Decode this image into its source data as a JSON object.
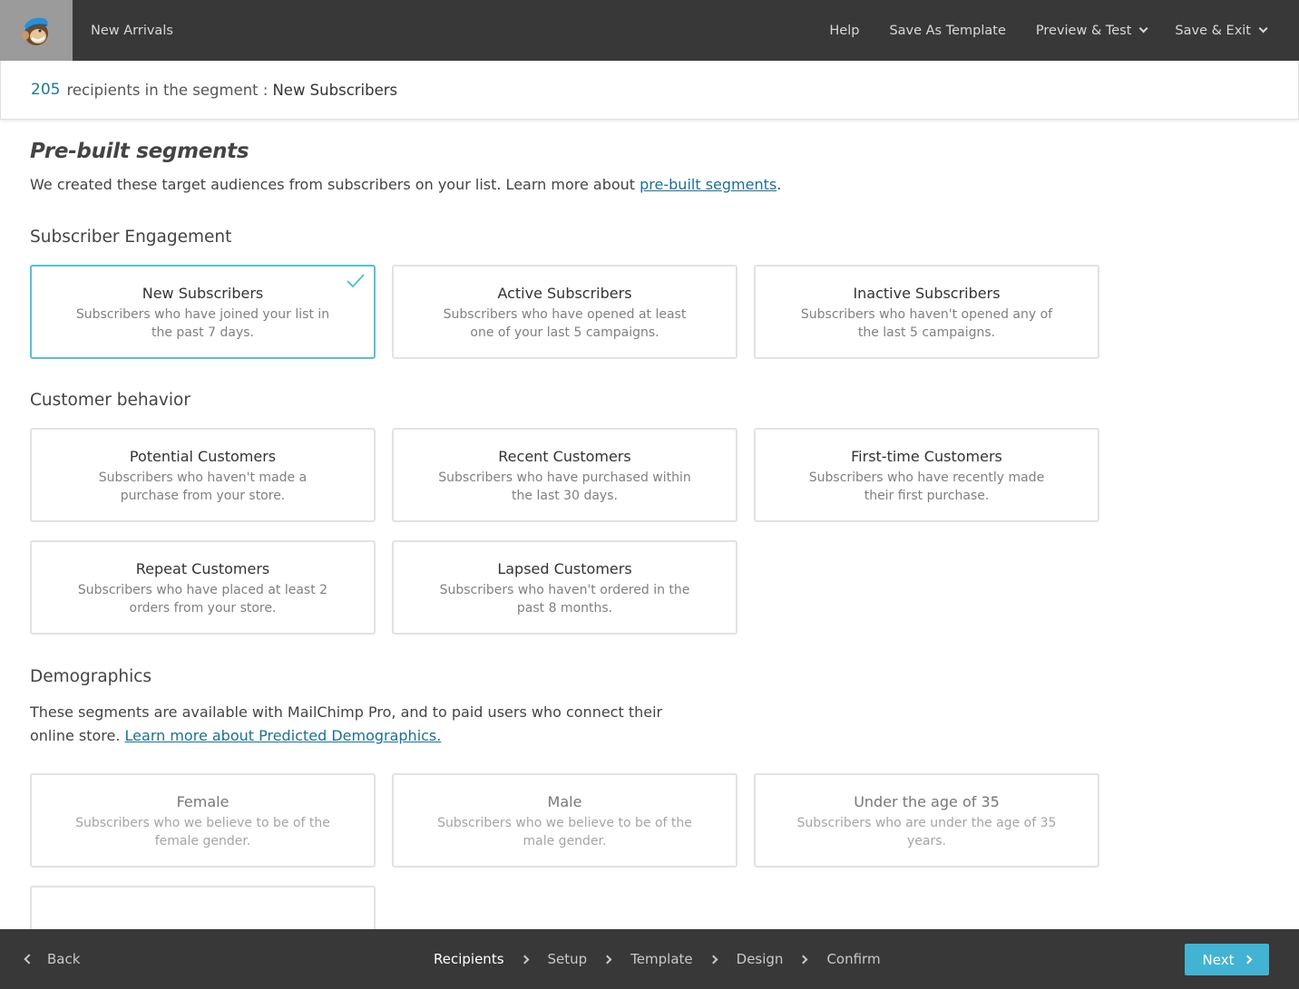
{
  "topbar": {
    "logo_icon": "mailchimp-freddie-logo",
    "campaign_name": "New Arrivals",
    "nav": [
      {
        "label": "Help",
        "dropdown": false
      },
      {
        "label": "Save As Template",
        "dropdown": false
      },
      {
        "label": "Preview & Test",
        "dropdown": true
      },
      {
        "label": "Save & Exit",
        "dropdown": true
      }
    ]
  },
  "recipients": {
    "count": "205",
    "label": "recipients in the segment :",
    "segment_name": "New Subscribers"
  },
  "colors": {
    "accent": "#43b3d3",
    "selected_border": "#5bbfd3",
    "link": "#1d6f95",
    "topbar_bg": "#383838"
  },
  "page": {
    "title": "Pre-built segments",
    "intro_text": "We created these target audiences from subscribers on your list. Learn more about ",
    "intro_link": "pre-built segments",
    "intro_end": "."
  },
  "sections": [
    {
      "heading": "Subscriber Engagement",
      "cards": [
        {
          "title": "New Subscribers",
          "desc": "Subscribers who have joined your list in the past 7 days.",
          "selected": true
        },
        {
          "title": "Active Subscribers",
          "desc": "Subscribers who have opened at least one of your last 5 campaigns.",
          "selected": false
        },
        {
          "title": "Inactive Subscribers",
          "desc": "Subscribers who haven't opened any of the last 5 campaigns.",
          "selected": false
        }
      ]
    },
    {
      "heading": "Customer behavior",
      "cards": [
        {
          "title": "Potential Customers",
          "desc": "Subscribers who haven't made a purchase from your store.",
          "selected": false
        },
        {
          "title": "Recent Customers",
          "desc": "Subscribers who have purchased within the last 30 days.",
          "selected": false
        },
        {
          "title": "First-time Customers",
          "desc": "Subscribers who have recently made their first purchase.",
          "selected": false
        },
        {
          "title": "Repeat Customers",
          "desc": "Subscribers who have placed at least 2 orders from your store.",
          "selected": false
        },
        {
          "title": "Lapsed Customers",
          "desc": "Subscribers who haven't ordered in the past 8 months.",
          "selected": false
        }
      ]
    },
    {
      "heading": "Demographics",
      "desc_text": "These segments are available with MailChimp Pro, and to paid users who connect their online store. ",
      "desc_link": "Learn more about Predicted Demographics.",
      "cards": [
        {
          "title": "Female",
          "desc": "Subscribers who we believe to be of the female gender.",
          "disabled": true
        },
        {
          "title": "Male",
          "desc": "Subscribers who we believe to be of the male gender.",
          "disabled": true
        },
        {
          "title": "Under the age of 35",
          "desc": "Subscribers who are under the age of 35 years.",
          "disabled": true
        }
      ]
    }
  ],
  "footer": {
    "back_label": "Back",
    "steps": [
      {
        "label": "Recipients",
        "active": true
      },
      {
        "label": "Setup",
        "active": false
      },
      {
        "label": "Template",
        "active": false
      },
      {
        "label": "Design",
        "active": false
      },
      {
        "label": "Confirm",
        "active": false
      }
    ],
    "next_label": "Next"
  }
}
